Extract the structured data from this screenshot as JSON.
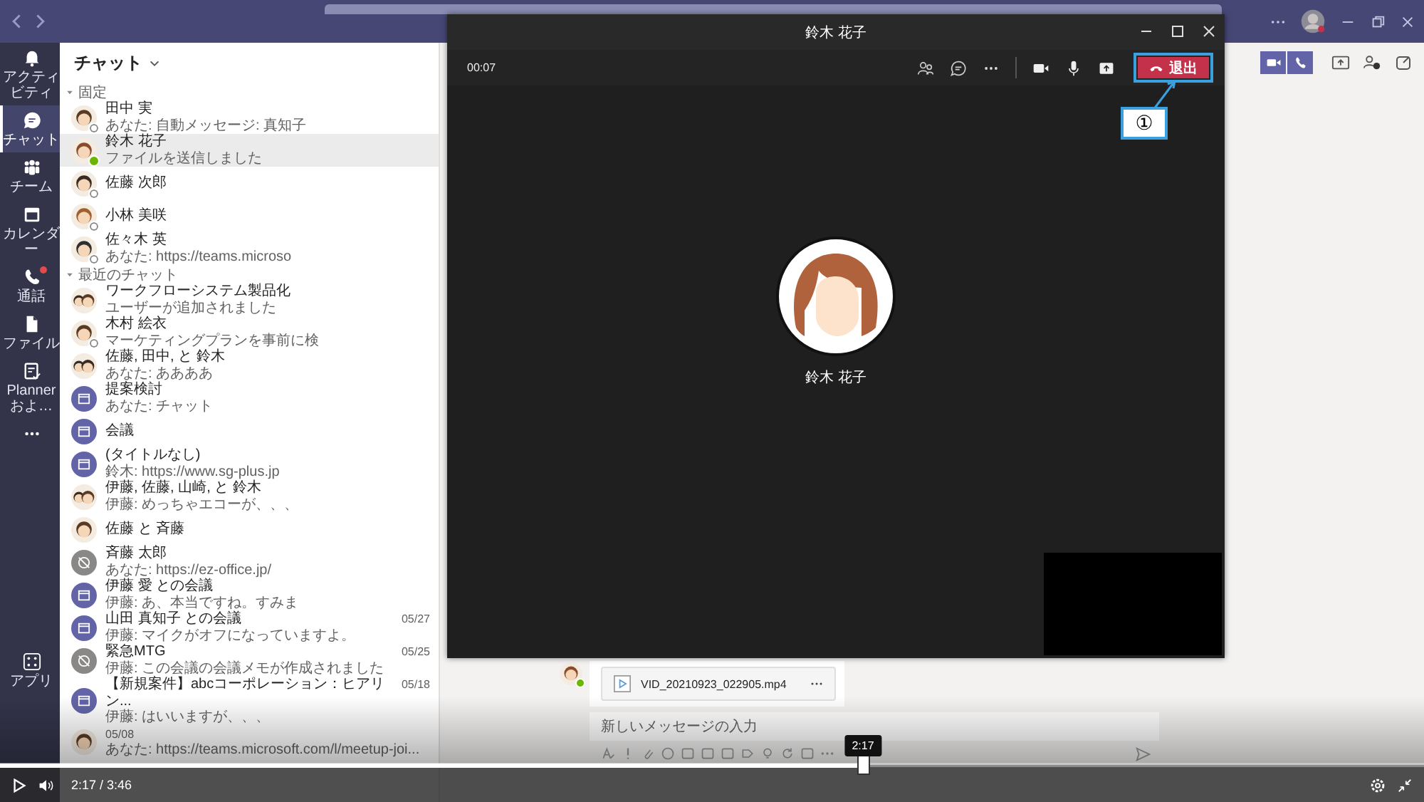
{
  "rail": [
    {
      "kind": "activity",
      "label": "アクティビティ",
      "selected": false,
      "badge": false
    },
    {
      "kind": "chat",
      "label": "チャット",
      "selected": true,
      "badge": false
    },
    {
      "kind": "teams",
      "label": "チーム",
      "selected": false,
      "badge": false
    },
    {
      "kind": "calendar",
      "label": "カレンダー",
      "selected": false,
      "badge": false
    },
    {
      "kind": "calls",
      "label": "通話",
      "selected": false,
      "badge": true
    },
    {
      "kind": "files",
      "label": "ファイル",
      "selected": false,
      "badge": false
    },
    {
      "kind": "planner",
      "label": "Planner およ…",
      "selected": false,
      "badge": false
    },
    {
      "kind": "more",
      "selected": false,
      "badge": false
    },
    {
      "kind": "apps",
      "label": "アプリ",
      "selected": false,
      "badge": false
    }
  ],
  "chat_list": {
    "title": "チャット",
    "sections": [
      {
        "label": "固定",
        "expanded": true,
        "chats": [
          {
            "name": "田中 実",
            "preview": "あなた: 自動メッセージ: 真知子",
            "kind": "person",
            "online": false,
            "selected": false
          },
          {
            "name": "鈴木 花子",
            "preview": "ファイルを送信しました",
            "kind": "person",
            "online": true,
            "selected": true
          },
          {
            "name": "佐藤 次郎",
            "kind": "person",
            "online": false,
            "selected": false
          },
          {
            "name": "小林 美咲",
            "kind": "person",
            "online": false,
            "selected": false
          },
          {
            "name": "佐々木 英",
            "preview": "あなた: https://teams.microso",
            "kind": "person",
            "online": false,
            "selected": false
          }
        ]
      },
      {
        "label": "最近のチャット",
        "expanded": true,
        "chats": [
          {
            "name": "ワークフローシステム製品化",
            "preview": "ユーザーが追加されました",
            "kind": "group",
            "selected": false
          },
          {
            "name": "木村 絵衣",
            "preview": "マーケティングプランを事前に検",
            "kind": "person",
            "online": false,
            "selected": false
          },
          {
            "name": "佐藤, 田中, と 鈴木",
            "preview": "あなた: ああああ",
            "kind": "group",
            "selected": false
          },
          {
            "name": "提案検討",
            "preview": "あなた: チャット",
            "kind": "meeting",
            "selected": false
          },
          {
            "name": "会議",
            "kind": "meeting",
            "selected": false
          },
          {
            "name": "(タイトルなし)",
            "preview": "鈴木: https://www.sg-plus.jp",
            "kind": "meeting",
            "selected": false
          },
          {
            "name": "伊藤, 佐藤, 山崎, と 鈴木",
            "preview": "伊藤: めっちゃエコーが、、、",
            "kind": "group",
            "selected": false
          },
          {
            "name": "佐藤 と 斉藤",
            "kind": "person",
            "selected": false
          },
          {
            "name": "斉藤 太郎",
            "preview": "あなた: https://ez-office.jp/",
            "kind": "blocked",
            "selected": false
          },
          {
            "name": "伊藤 愛 との会議",
            "preview": "伊藤: あ、本当ですね。すみま",
            "kind": "meeting",
            "selected": false
          },
          {
            "name": "山田 真知子 との会議",
            "preview": "伊藤: マイクがオフになっていますよ。",
            "date": "05/27",
            "kind": "meeting",
            "selected": false
          },
          {
            "name": "緊急MTG",
            "preview": "伊藤: この会議の会議メモが作成されました",
            "date": "05/25",
            "kind": "blocked",
            "selected": false
          },
          {
            "name": "【新規案件】abcコーポレーション：ヒアリン...",
            "preview": "伊藤: はいいますが、、、",
            "date": "05/18",
            "kind": "meeting",
            "selected": false
          },
          {
            "preview": "あなた: https://teams.microsoft.com/l/meetup-joi...",
            "date": "05/08",
            "kind": "person",
            "selected": false
          }
        ]
      }
    ]
  },
  "conversation": {
    "attachment": {
      "file_name": "VID_20210923_022905.mp4"
    },
    "compose": {
      "placeholder": "新しいメッセージの入力"
    }
  },
  "call": {
    "title": "鈴木 花子",
    "elapsed": "00:07",
    "leave_label": "退出",
    "leave_highlighted": true,
    "callout": "①",
    "participant": {
      "name": "鈴木 花子"
    }
  },
  "player": {
    "playing": false,
    "time": "2:17 / 3:46",
    "level": 0.606,
    "tooltip": "2:17"
  }
}
